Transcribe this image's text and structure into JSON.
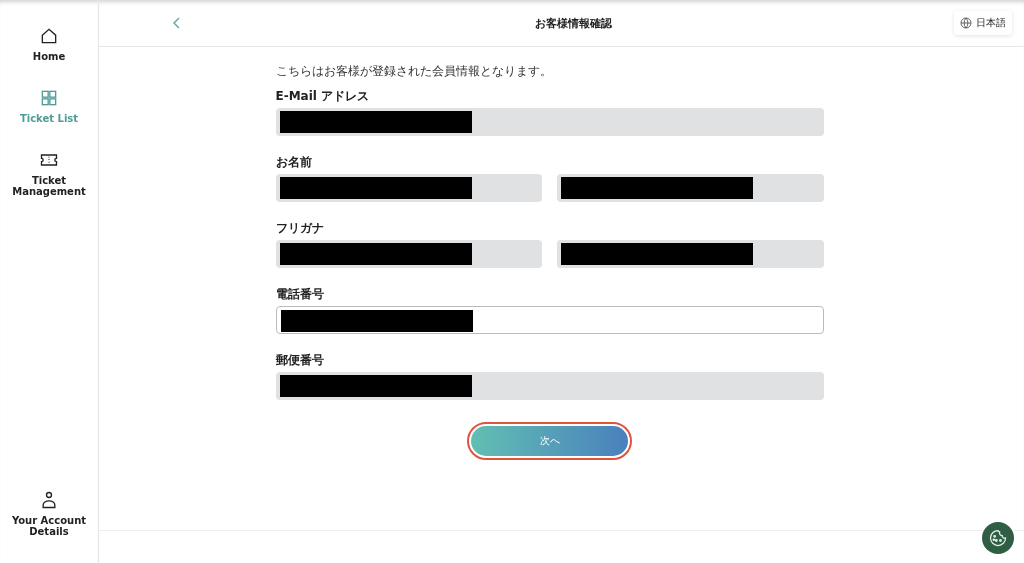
{
  "sidebar": {
    "items": [
      {
        "kind": "home",
        "label": "Home",
        "selected": false
      },
      {
        "kind": "grid",
        "label": "Ticket List",
        "selected": true
      },
      {
        "kind": "ticket",
        "label": "Ticket Management",
        "selected": false
      }
    ],
    "bottom_item": {
      "kind": "person",
      "label": "Your Account Details",
      "selected": false
    }
  },
  "header": {
    "title": "お客様情報確認",
    "language": "日本語"
  },
  "intro": "こちらはお客様が登録された会員情報となります。",
  "sections": [
    {
      "label": "E-Mail アドレス",
      "fields": [
        {
          "kind": "readonly",
          "redacted": true
        }
      ]
    },
    {
      "label": "お名前",
      "fields": [
        {
          "kind": "readonly",
          "redacted": true
        },
        {
          "kind": "readonly",
          "redacted": true
        }
      ]
    },
    {
      "label": "フリガナ",
      "fields": [
        {
          "kind": "readonly",
          "redacted": true
        },
        {
          "kind": "readonly",
          "redacted": true
        }
      ]
    },
    {
      "label": "電話番号",
      "fields": [
        {
          "kind": "editable",
          "redacted": true
        }
      ]
    },
    {
      "label": "郵便番号",
      "fields": [
        {
          "kind": "readonly",
          "redacted": true
        }
      ]
    }
  ],
  "next_button": {
    "label": "次へ",
    "highlighted": true
  }
}
